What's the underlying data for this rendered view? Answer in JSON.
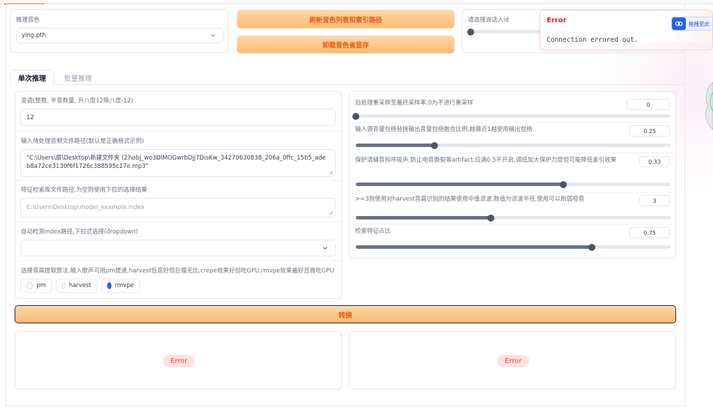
{
  "model": {
    "label": "推理音色",
    "selected": "ying.pth"
  },
  "buttons": {
    "refresh": "刷新音色列表和索引路径",
    "unload": "卸载音色省显存",
    "convert": "转换"
  },
  "speaker": {
    "label": "请选择说话人id"
  },
  "toast": {
    "title": "Error",
    "message": "Connection errored out."
  },
  "extension": {
    "label": "拖拽至此"
  },
  "tabs": [
    {
      "label": "单次推理",
      "active": true
    },
    {
      "label": "批量推理",
      "active": false
    }
  ],
  "left": {
    "transpose": {
      "label": "变调(整数, 半音数量, 升八度12降八度-12)",
      "value": "12"
    },
    "input_path": {
      "label": "输入待处理音频文件路径(默认是正确格式示例)",
      "value": "\"C:\\Users\\辰\\Desktop\\新建文件夹 (2)\\obj_wo3DlMOGwrbDjj7DisKw_34270630838_206a_0ffc_15b5_adeb8a72ce3130f6f1726c388595c17e.mp3\""
    },
    "index_path": {
      "label": "特征检索库文件路径,为空则使用下拉的选择结果",
      "placeholder": "C:\\Users\\Desktop\\model_example.index"
    },
    "auto_index": {
      "label": "自动检测index路径,下拉式选择(dropdown)",
      "value": ""
    },
    "f0": {
      "label": "选择音高提取算法,输入歌声可用pm提速,harvest低音好但巨慢无比,crepe效果好但吃GPU,rmvpe效果最好且微吃GPU",
      "options": [
        "pm",
        "harvest",
        "rmvpe"
      ],
      "selected": "rmvpe"
    }
  },
  "right": {
    "sliders": [
      {
        "label": "后处理重采样至最终采样率,0为不进行重采样",
        "value": "0",
        "fraction": 0.0
      },
      {
        "label": "输入源音量包络替换输出音量包络融合比例,越靠近1越使用输出包络",
        "value": "0.25",
        "fraction": 0.25
      },
      {
        "label": "保护清辅音和呼吸声,防止电音撕裂等artifact,拉满0.5不开启,调低加大保护力度但可能降低索引效果",
        "value": "0.33",
        "fraction": 0.66
      },
      {
        "label": ">=3则使用对harvest音高识别的结果使用中值滤波,数值为滤波半径,使用可以削弱哑音",
        "value": "3",
        "fraction": 0.43
      },
      {
        "label": "检索特征占比",
        "value": "0.75",
        "fraction": 0.75
      }
    ]
  },
  "outputs": {
    "left_status": "Error",
    "right_status": "Error"
  },
  "colors": {
    "accent": "#f97316",
    "button_gradient_top": "#fed7aa",
    "button_gradient_bottom": "#fdba74",
    "button_text": "#ea580c",
    "error": "#ef4444",
    "radio_selected": "#2563eb"
  }
}
